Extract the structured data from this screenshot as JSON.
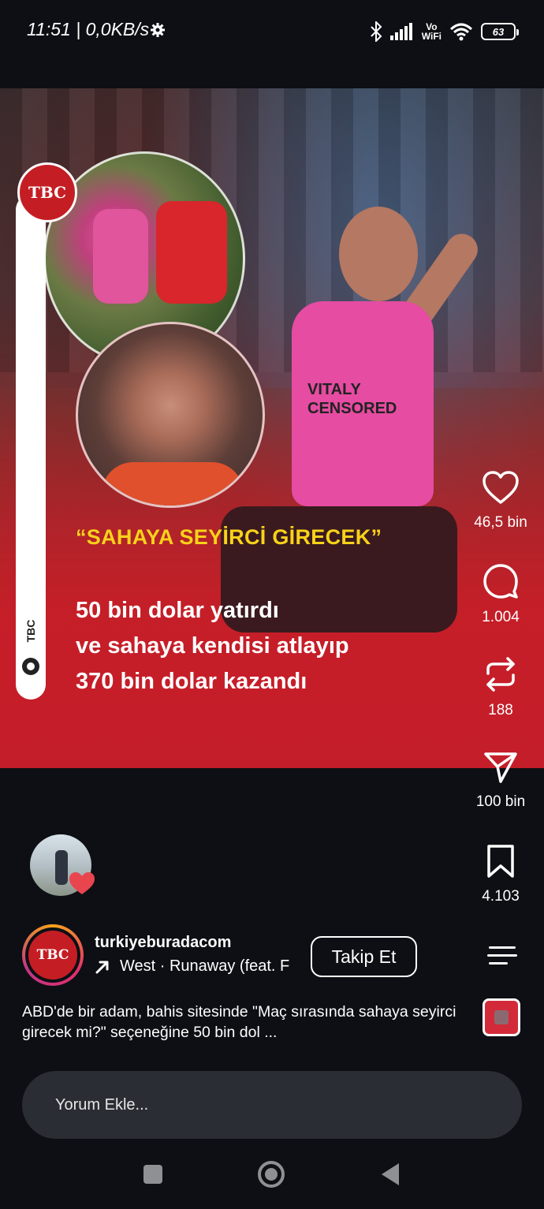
{
  "status_bar": {
    "time": "11:51 | 0,0KB/s",
    "network_label_top": "Vo",
    "network_label_bottom": "WiFi",
    "battery": "63"
  },
  "post": {
    "image_badge": "TBC",
    "side_label": "TBC",
    "headline": "“SAHAYA SEYİRCİ GİRECEK”",
    "body_lines": [
      "50 bin dolar yatırdı",
      "ve sahaya kendisi atlayıp",
      "370 bin dolar kazandı"
    ],
    "shirt_text": [
      "VITALY",
      "CENSORED"
    ]
  },
  "actions": {
    "likes": "46,5 bin",
    "comments": "1.004",
    "reposts": "188",
    "shares": "100 bin",
    "saves": "4.103"
  },
  "account": {
    "avatar_text": "TBC",
    "username": "turkiyeburadacom",
    "audio": "West · Runaway (feat. F",
    "follow_label": "Takip Et"
  },
  "caption": "ABD'de bir adam, bahis sitesinde \"Maç sırasında sahaya seyirci girecek mi?\" seçeneğine 50 bin dol ...",
  "comment": {
    "placeholder": "Yorum Ekle..."
  },
  "colors": {
    "background": "#0d0f14",
    "headline_yellow": "#f7d21a",
    "brand_red": "#c41e24",
    "like_heart": "#e8454f"
  },
  "icons": {
    "like": "heart-icon",
    "comment": "comment-bubble-icon",
    "repost": "repost-icon",
    "share": "paper-plane-icon",
    "save": "bookmark-icon",
    "audio": "arrow-up-right-icon",
    "menu": "menu-icon"
  }
}
